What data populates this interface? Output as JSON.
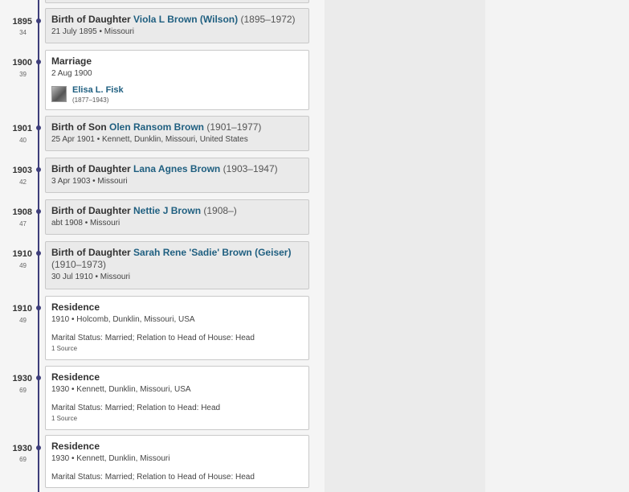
{
  "events": [
    {
      "year": "1895",
      "age": "34",
      "kind": "Birth of Daughter",
      "link": "Viola L Brown (Wilson)",
      "dates": "(1895–1972)",
      "sub": "21 July 1895 • Missouri"
    },
    {
      "year": "1900",
      "age": "39",
      "kind": "Marriage",
      "sub": "2 Aug 1900",
      "spouse": {
        "name": "Elisa L. Fisk",
        "dates": "(1877–1943)"
      }
    },
    {
      "year": "1901",
      "age": "40",
      "kind": "Birth of Son",
      "link": "Olen Ransom Brown",
      "dates": "(1901–1977)",
      "sub": "25 Apr 1901 • Kennett, Dunklin, Missouri, United States"
    },
    {
      "year": "1903",
      "age": "42",
      "kind": "Birth of Daughter",
      "link": "Lana Agnes Brown",
      "dates": "(1903–1947)",
      "sub": "3 Apr 1903 • Missouri"
    },
    {
      "year": "1908",
      "age": "47",
      "kind": "Birth of Daughter",
      "link": "Nettie J Brown",
      "dates": "(1908–)",
      "sub": "abt 1908 • Missouri"
    },
    {
      "year": "1910",
      "age": "49",
      "kind": "Birth of Daughter",
      "link": "Sarah Rene 'Sadie' Brown (Geiser)",
      "dates": "(1910–1973)",
      "sub": "30 Jul 1910 • Missouri"
    },
    {
      "year": "1910",
      "age": "49",
      "kind": "Residence",
      "sub": "1910 • Holcomb, Dunklin, Missouri, USA",
      "detail": "Marital Status: Married; Relation to Head of House: Head",
      "source": "1 Source"
    },
    {
      "year": "1930",
      "age": "69",
      "kind": "Residence",
      "sub": "1930 • Kennett, Dunklin, Missouri, USA",
      "detail": "Marital Status: Married; Relation to Head: Head",
      "source": "1 Source"
    },
    {
      "year": "1930",
      "age": "69",
      "kind": "Residence",
      "sub": "1930 • Kennett, Dunklin, Missouri",
      "detail": "Marital Status: Married; Relation to Head of House: Head"
    }
  ]
}
